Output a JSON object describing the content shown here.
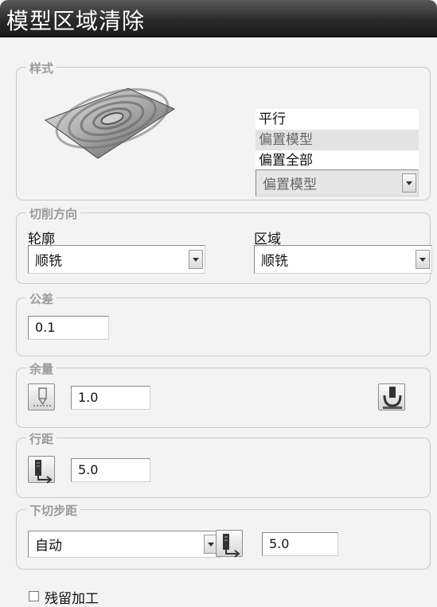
{
  "window": {
    "title": "模型区域清除"
  },
  "style_group": {
    "legend": "样式",
    "image_icon": "offset-toolpath-preview-icon",
    "options": [
      "平行",
      "偏置模型",
      "偏置全部"
    ],
    "selected_index": 1,
    "dropdown_value": "偏置模型"
  },
  "cut_direction": {
    "legend": "切削方向",
    "profile_label": "轮廓",
    "profile_value": "顺铣",
    "area_label": "区域",
    "area_value": "顺铣"
  },
  "tolerance": {
    "legend": "公差",
    "value": "0.1"
  },
  "thickness": {
    "legend": "余量",
    "value": "1.0",
    "left_icon": "component-thickness-icon",
    "right_icon": "thickness-settings-icon"
  },
  "stepover": {
    "legend": "行距",
    "value": "5.0",
    "icon": "copy-from-tool-icon"
  },
  "stepdown": {
    "legend": "下切步距",
    "mode_value": "自动",
    "value": "5.0",
    "icon": "copy-from-tool-icon"
  },
  "rest_machining": {
    "label": "残留加工",
    "checked": false
  }
}
